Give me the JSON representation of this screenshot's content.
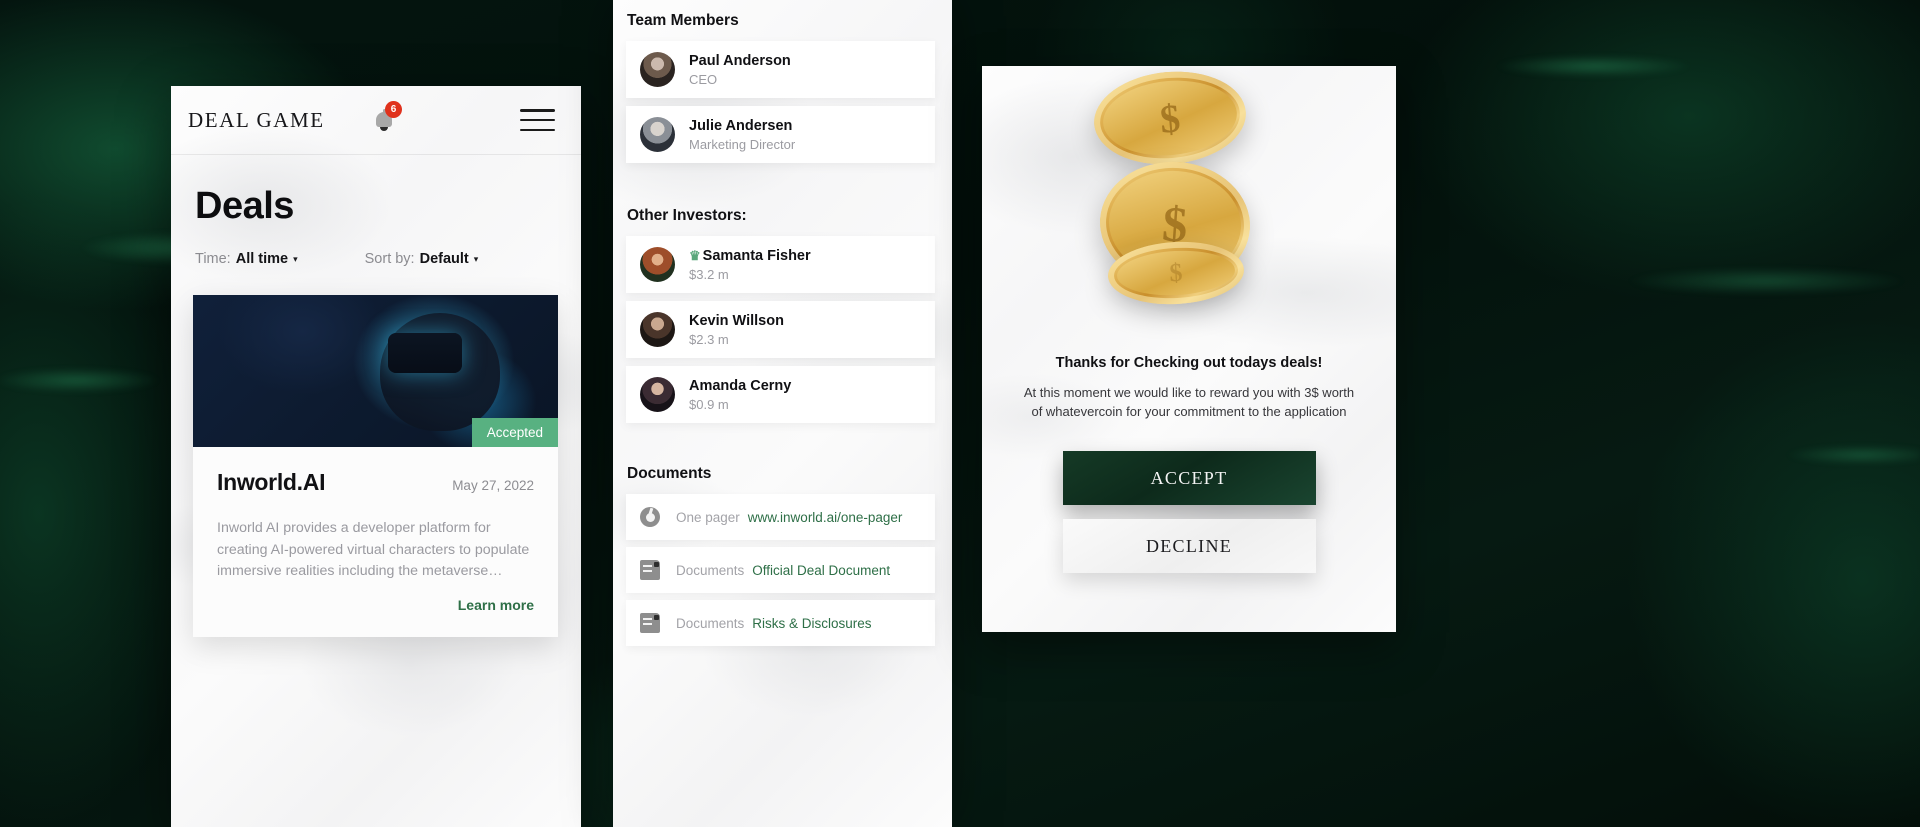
{
  "app": {
    "brand": "DEAL GAME",
    "notification_count": "6",
    "page_title": "Deals"
  },
  "filters": {
    "time": {
      "label": "Time:",
      "value": "All time",
      "caret": "▾"
    },
    "sort": {
      "label": "Sort by:",
      "value": "Default",
      "caret": "▾"
    }
  },
  "deal": {
    "status": "Accepted",
    "name": "Inworld.AI",
    "date": "May 27, 2022",
    "description": "Inworld AI provides a developer platform for creating AI-powered virtual characters to populate immersive realities including the metaverse…",
    "learn_more": "Learn more"
  },
  "team": {
    "title": "Team Members",
    "members": [
      {
        "name": "Paul Anderson",
        "role": "CEO"
      },
      {
        "name": "Julie Andersen",
        "role": "Marketing Director"
      }
    ]
  },
  "investors": {
    "title": "Other Investors:",
    "crown": "♛",
    "list": [
      {
        "name": "Samanta Fisher",
        "amount": "$3.2 m",
        "crowned": true
      },
      {
        "name": "Kevin Willson",
        "amount": "$2.3 m",
        "crowned": false
      },
      {
        "name": "Amanda Cerny",
        "amount": "$0.9 m",
        "crowned": false
      }
    ]
  },
  "documents": {
    "title": "Documents",
    "items": [
      {
        "icon": "chrome-icon",
        "label": "One pager",
        "link": "www.inworld.ai/one-pager"
      },
      {
        "icon": "document-icon",
        "label": "Documents",
        "link": "Official Deal Document"
      },
      {
        "icon": "document-icon",
        "label": "Documents",
        "link": "Risks & Disclosures"
      }
    ]
  },
  "reward": {
    "heading": "Thanks for Checking out todays deals!",
    "body": "At this moment we would like to reward you with 3$ worth of whatevercoin for your commitment to the application",
    "accept_label": "ACCEPT",
    "decline_label": "DECLINE",
    "coin_symbol": "$"
  },
  "colors": {
    "accent_green": "#2e6f47",
    "status_green": "#58b181",
    "badge_red": "#e0321d",
    "gold": "#e0b152"
  }
}
